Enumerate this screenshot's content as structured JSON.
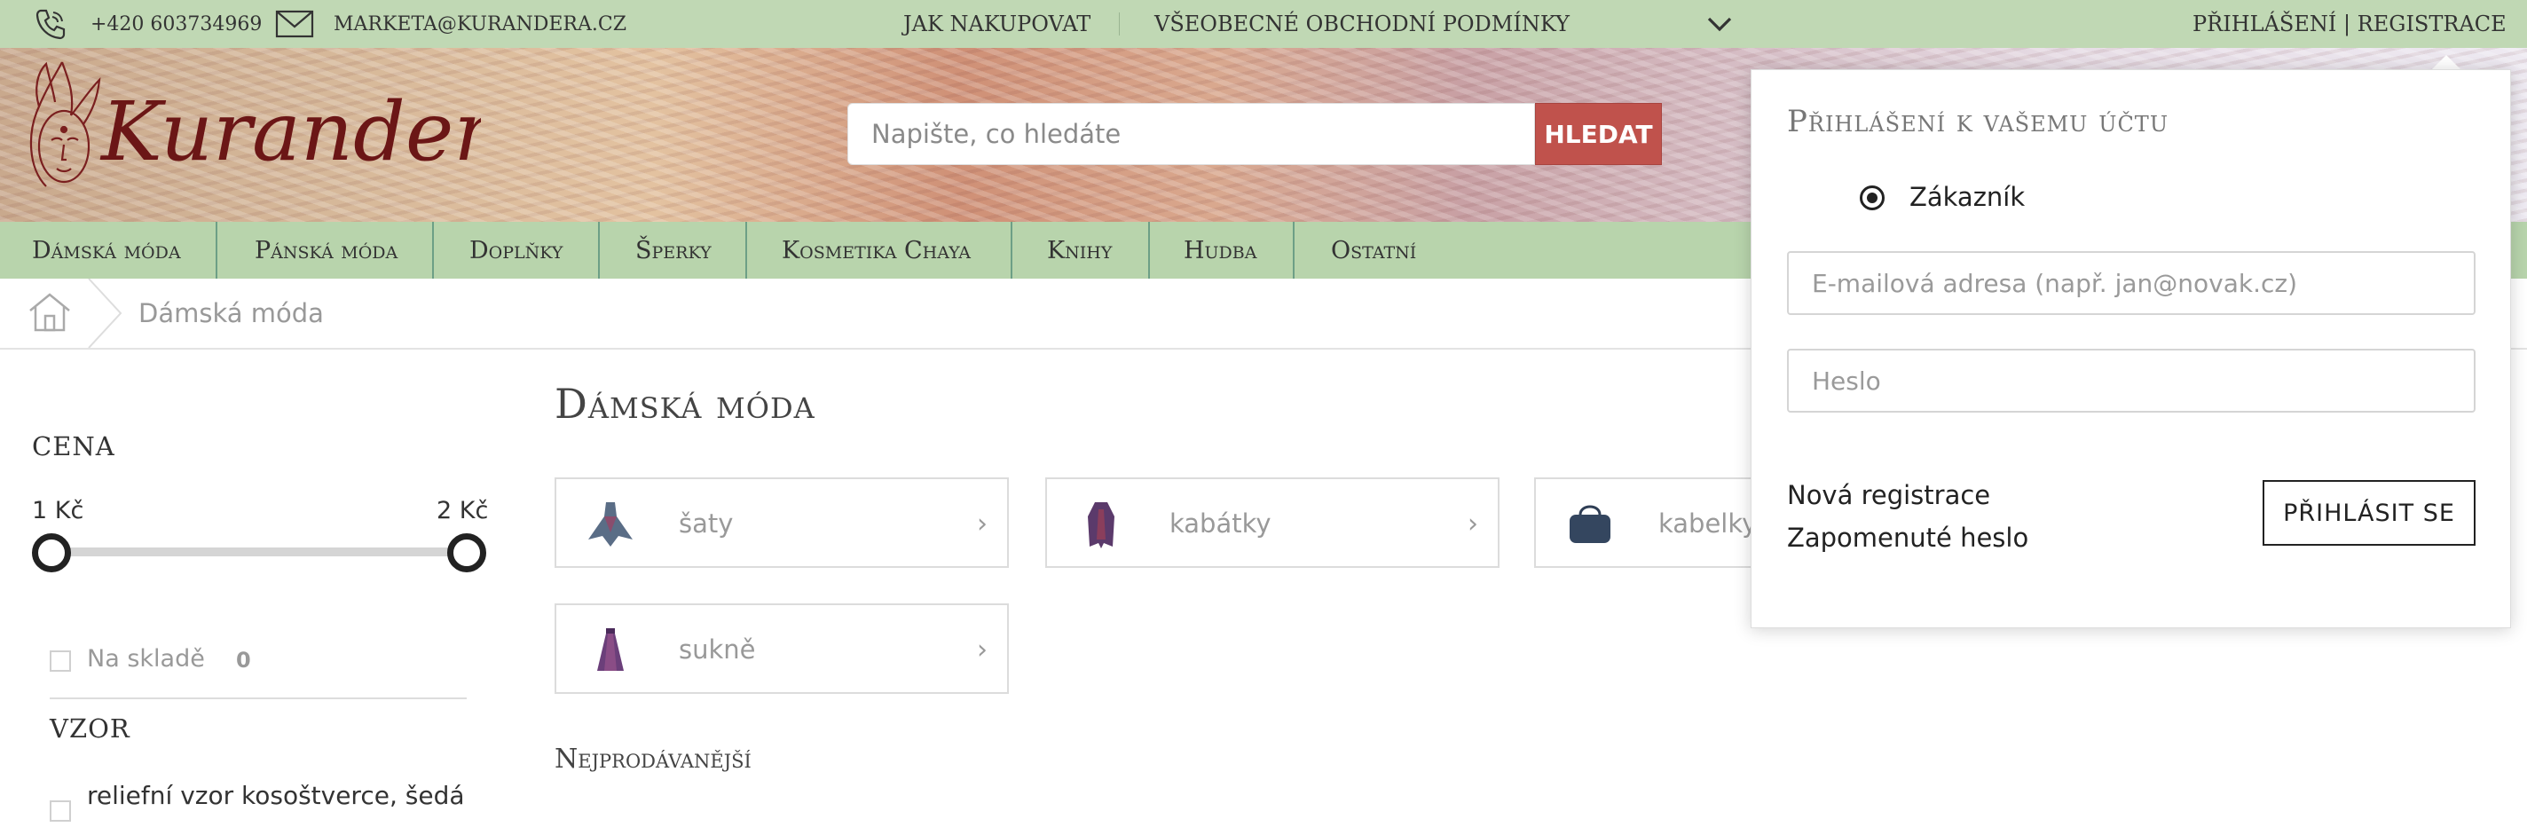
{
  "topbar": {
    "phone": "+420 603734969",
    "email": "MARKETA@KURANDERA.CZ",
    "links": [
      "JAK NAKUPOVAT",
      "VŠEOBECNÉ OBCHODNÍ PODMÍNKY"
    ],
    "account": "PŘIHLÁŠENÍ | REGISTRACE"
  },
  "header": {
    "logo_text": "Kurandera.cz",
    "search_placeholder": "Napište, co hledáte",
    "search_button": "HLEDAT"
  },
  "nav": {
    "items": [
      "Dámská móda",
      "Pánská móda",
      "Doplňky",
      "Šperky",
      "Kosmetika Chaya",
      "Knihy",
      "Hudba",
      "Ostatní"
    ]
  },
  "breadcrumb": {
    "current": "Dámská móda"
  },
  "sidebar": {
    "price_heading": "CENA",
    "price_min": "1 Kč",
    "price_max": "2 Kč",
    "stock_label": "Na skladě",
    "stock_count": "0",
    "pattern_heading": "VZOR",
    "pattern_option": "reliefní vzor kosoštverce, šedá"
  },
  "main": {
    "title": "Dámská móda",
    "categories": [
      {
        "name": "šaty",
        "arrow": "›"
      },
      {
        "name": "kabátky",
        "arrow": "›"
      },
      {
        "name": "kabelky",
        "arrow": "›"
      },
      {
        "name": "sukně",
        "arrow": "›"
      }
    ],
    "bestsellers": "Nejprodávanější"
  },
  "login": {
    "title": "Přihlášení k vašemu účtu",
    "radio_label": "Zákazník",
    "email_placeholder": "E-mailová adresa (např. jan@novak.cz)",
    "password_placeholder": "Heslo",
    "new_registration": "Nová registrace",
    "forgot_password": "Zapomenuté heslo",
    "submit": "PŘIHLÁSIT SE"
  }
}
